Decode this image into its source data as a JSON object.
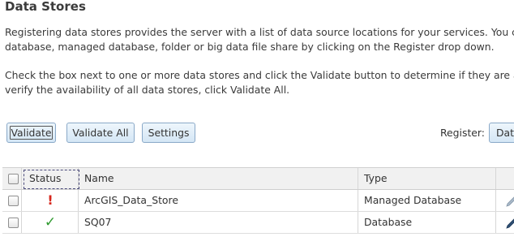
{
  "page": {
    "title": "Data Stores",
    "paragraph1_line1": "Registering data stores provides the server with a list of data source locations for your services. You can",
    "paragraph1_line2": "database, managed database, folder or big data file share by clicking on the Register drop down.",
    "paragraph2_line1": "Check the box next to one or more data stores and click the Validate button to determine if they are avail",
    "paragraph2_line2": "verify the availability of all data stores, click Validate All."
  },
  "toolbar": {
    "validate_label": "Validate",
    "validate_all_label": "Validate All",
    "settings_label": "Settings",
    "register_label": "Register:",
    "register_value": "Dat"
  },
  "table": {
    "columns": [
      "Status",
      "Name",
      "Type"
    ],
    "rows": [
      {
        "status": "warning-icon",
        "name": "ArcGIS_Data_Store",
        "type": "Managed Database"
      },
      {
        "status": "check-icon",
        "name": "SQ07",
        "type": "Database"
      }
    ]
  },
  "colors": {
    "warning": "#d6261c",
    "ok": "#2f9a2f",
    "button_border": "#8aa9c8"
  }
}
